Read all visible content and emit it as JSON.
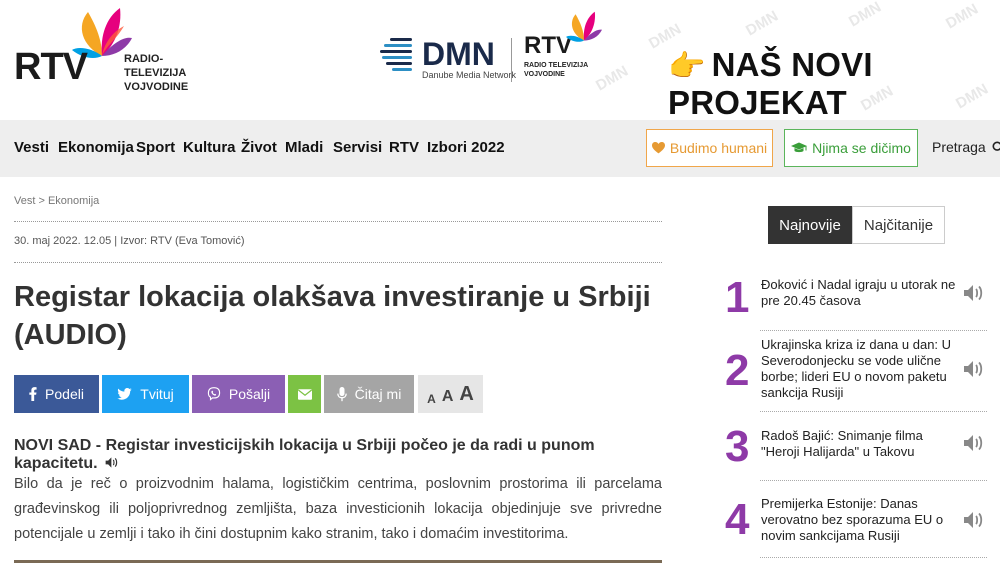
{
  "header": {
    "logo_text": "RTV",
    "logo_sub_line1": "RADIO-TELEVIZIJA",
    "logo_sub_line2": "VOJVODINE",
    "dmn_text": "DMN",
    "dmn_sub": "Danube Media Network",
    "dmn_rtv_text": "RTV",
    "dmn_rtv_sub_line1": "RADIO TELEVIZIJA",
    "dmn_rtv_sub_line2": "VOJVODINE",
    "watermark": "DMN",
    "promo_icon": "pointing-hand-icon",
    "promo_text": "NAŠ NOVI PROJEKAT"
  },
  "nav": {
    "items": [
      "Vesti",
      "Ekonomija",
      "Sport",
      "Kultura",
      "Život",
      "Mladi",
      "Servisi",
      "RTV",
      "Izbori 2022"
    ],
    "humani_label": "Budimo humani",
    "dicimo_label": "Njima se dičimo",
    "search_label": "Pretraga"
  },
  "article": {
    "breadcrumb": "Vest > Ekonomija",
    "meta": "30. maj  2022. 12.05  |  Izvor: RTV (Eva Tomović)",
    "title": "Registar lokacija olakšava investiranje u Srbiji (AUDIO)",
    "share": {
      "podeli": "Podeli",
      "tvituj": "Tvituj",
      "posalji": "Pošalji",
      "citaj": "Čitaj mi",
      "font_small": "A",
      "font_mid": "A",
      "font_large": "A"
    },
    "lead": "NOVI SAD - Registar investicijskih lokacija u Srbiji počeo je da radi u punom kapacitetu.",
    "body": "Bilo da je reč o proizvodnim halama, logističkim centrima, poslovnim prostorima ili parcelama građevinskog ili poljoprivrednog zemljišta, baza investicionih lokacija objedinjuje sve privredne potencijale u zemlji i tako ih čini dostupnim kako stranim, tako i domaćim investitorima."
  },
  "sidebar": {
    "tab_newest": "Najnovije",
    "tab_most_read": "Najčitanije",
    "news": [
      {
        "num": "1",
        "text": "Đoković i Nadal igraju u utorak ne pre 20.45 časova"
      },
      {
        "num": "2",
        "text": "Ukrajinska kriza iz dana u dan: U Severodonjecku se vode ulične borbe; lideri EU o novom paketu sankcija Rusiji"
      },
      {
        "num": "3",
        "text": "Radoš Bajić: Snimanje filma \"Heroji Halijarda\" u Takovu"
      },
      {
        "num": "4",
        "text": "Premijerka Estonije: Danas verovatno bez sporazuma EU o novim sankcijama Rusiji"
      }
    ]
  },
  "colors": {
    "facebook": "#3b5998",
    "twitter": "#1da1f2",
    "viber": "#8b5fb4",
    "email": "#7cc244",
    "listen": "#a5a5a5",
    "accent_purple": "#8e3aa7",
    "humani": "#e69a33",
    "dicimo": "#3a9e3a"
  }
}
